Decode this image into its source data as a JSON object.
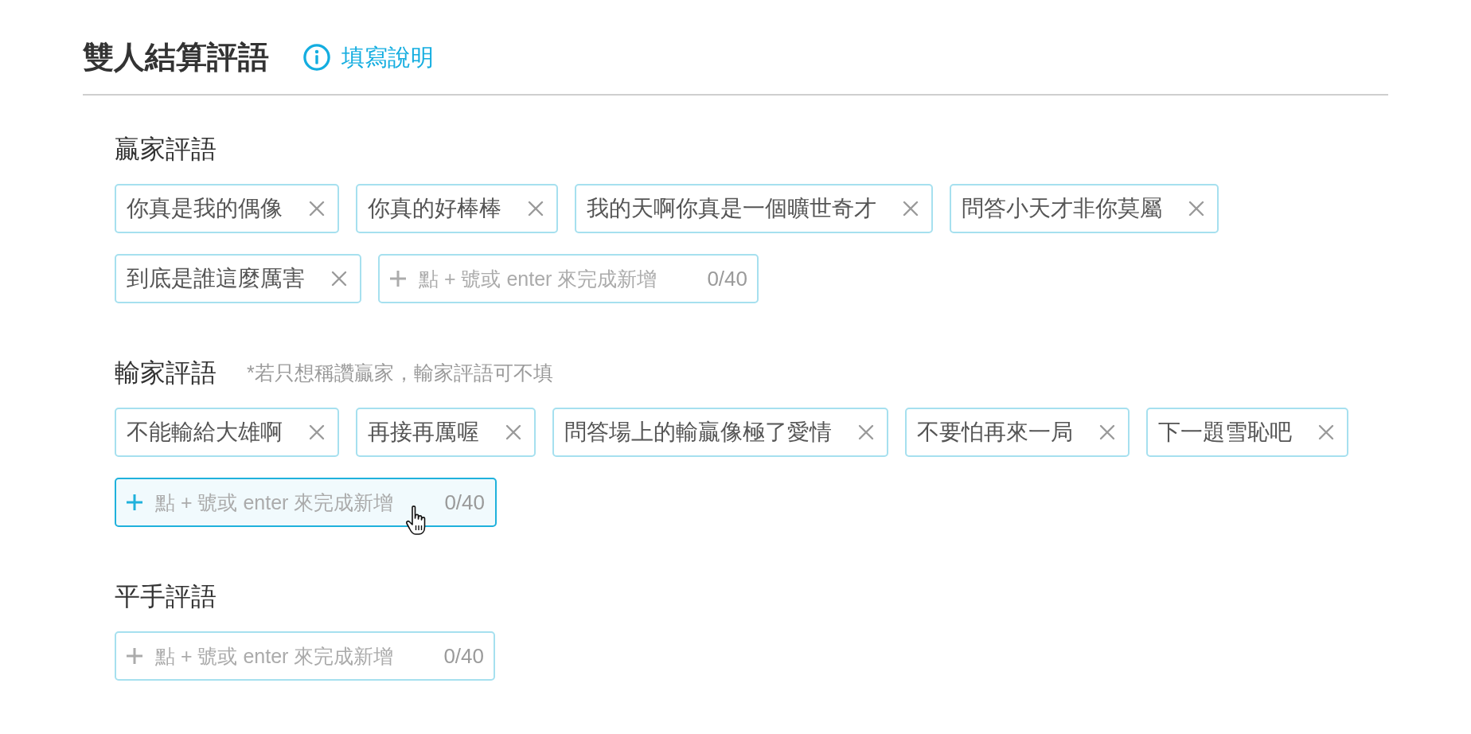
{
  "header": {
    "title": "雙人結算評語",
    "help_link": "填寫說明"
  },
  "sections": [
    {
      "label": "贏家評語",
      "tags": [
        "你真是我的偶像",
        "你真的好棒棒",
        "我的天啊你真是一個曠世奇才",
        "問答小天才非你莫屬",
        "到底是誰這麼厲害"
      ],
      "input": {
        "placeholder": "點 + 號或 enter 來完成新增",
        "counter": "0/40",
        "hovered": false
      }
    },
    {
      "label": "輸家評語",
      "note": "*若只想稱讚贏家，輸家評語可不填",
      "tags": [
        "不能輸給大雄啊",
        "再接再厲喔",
        "問答場上的輸贏像極了愛情",
        "不要怕再來一局",
        "下一題雪恥吧"
      ],
      "input": {
        "placeholder": "點 + 號或 enter 來完成新增",
        "counter": "0/40",
        "hovered": true
      }
    },
    {
      "label": "平手評語",
      "input": {
        "placeholder": "點 + 號或 enter 來完成新增",
        "counter": "0/40",
        "hovered": false
      }
    }
  ]
}
